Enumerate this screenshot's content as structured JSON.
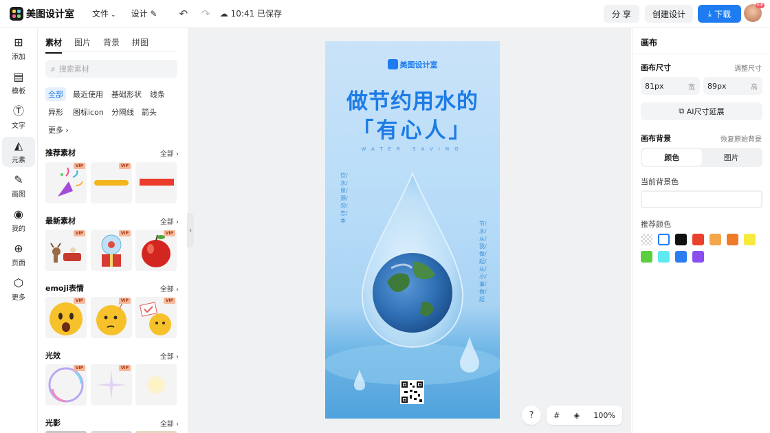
{
  "app": {
    "title": "美图设计室"
  },
  "topbar": {
    "file_menu": "文件",
    "design_menu": "设计",
    "save_status": "10:41 已保存",
    "share": "分 享",
    "create_design": "创建设计",
    "download": "下载",
    "avatar_badge": "VIP"
  },
  "rail": [
    {
      "label": "添加",
      "icon": "plus-square-icon"
    },
    {
      "label": "模板",
      "icon": "template-icon"
    },
    {
      "label": "文字",
      "icon": "text-icon"
    },
    {
      "label": "元素",
      "icon": "shapes-icon"
    },
    {
      "label": "画图",
      "icon": "pen-icon"
    },
    {
      "label": "我的",
      "icon": "user-icon"
    },
    {
      "label": "页面",
      "icon": "page-add-icon"
    },
    {
      "label": "更多",
      "icon": "cube-icon"
    }
  ],
  "panel": {
    "tabs": [
      "素材",
      "图片",
      "背景",
      "拼图"
    ],
    "search_placeholder": "搜索素材",
    "chips": [
      "全部",
      "最近使用",
      "基础形状",
      "线条",
      "异形",
      "图标icon",
      "分隔线",
      "箭头",
      "更多"
    ],
    "all_label": "全部",
    "vip_label": "VIP",
    "sections": [
      "推荐素材",
      "最新素材",
      "emoji表情",
      "光效",
      "光影"
    ]
  },
  "poster": {
    "brand": "美图设计室",
    "title1": "做节约用水的",
    "title2": "「有心人」",
    "subtitle": "WATER SAVING",
    "vertical_left": "饮/水/思/源/勿/忘/本",
    "vertical_right": "节/水/从/我/做/起/从/小/事/做/起"
  },
  "zoom": {
    "help": "?",
    "grid": "#",
    "level": "100%"
  },
  "right": {
    "title": "画布",
    "size_label": "画布尺寸",
    "resize_link": "调整尺寸",
    "width_value": "81px",
    "width_unit": "宽",
    "height_value": "89px",
    "height_unit": "高",
    "ai_button": "AI尺寸延展",
    "bg_label": "画布背景",
    "restore_link": "恢复原始背景",
    "seg_color": "颜色",
    "seg_image": "图片",
    "current_bg_label": "当前背景色",
    "recommended_label": "推荐颜色",
    "swatches": [
      "transparent",
      "#ffffff",
      "#111111",
      "#e8412c",
      "#f4a64b",
      "#ee7a2a",
      "#f7ea3e",
      "#5bcf3f",
      "#5eeaf0",
      "#2b7df0",
      "#8a4df0"
    ]
  }
}
